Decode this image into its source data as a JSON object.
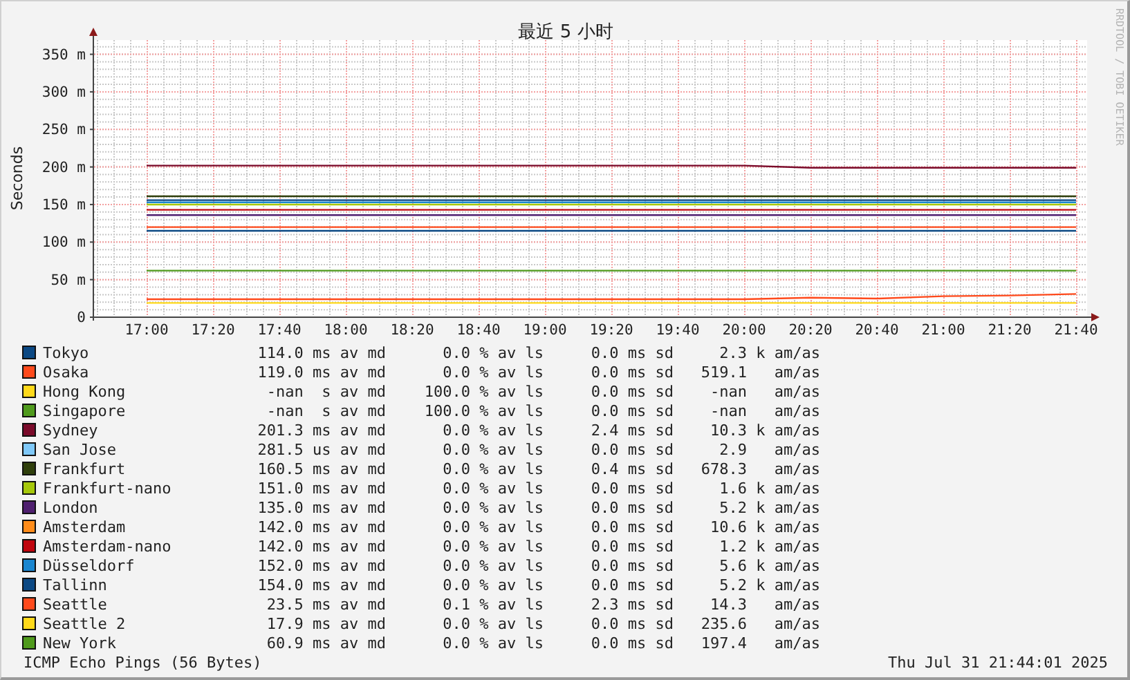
{
  "chart": {
    "credit": "RRDTOOL / TOBI OETIKER",
    "chart_data": {
      "type": "line",
      "title": "最近 5 小时",
      "ylabel": "Seconds",
      "grid": true,
      "categories": [
        "17:00",
        "17:20",
        "17:40",
        "18:00",
        "18:20",
        "18:40",
        "19:00",
        "19:20",
        "19:40",
        "20:00",
        "20:20",
        "20:40",
        "21:00",
        "21:20",
        "21:40"
      ],
      "ylim": [
        0,
        368
      ],
      "yticks": [
        {
          "value": 0,
          "label": "0"
        },
        {
          "value": 50,
          "label": "50 m"
        },
        {
          "value": 100,
          "label": "100 m"
        },
        {
          "value": 150,
          "label": "150 m"
        },
        {
          "value": 200,
          "label": "200 m"
        },
        {
          "value": 250,
          "label": "250 m"
        },
        {
          "value": 300,
          "label": "300 m"
        },
        {
          "value": 350,
          "label": "350 m"
        }
      ],
      "series": [
        {
          "name": "Tokyo",
          "color": "#0b4883",
          "values": [
            114,
            114,
            114,
            114,
            114,
            114,
            114,
            114,
            114,
            114,
            114,
            114,
            114,
            114,
            114
          ]
        },
        {
          "name": "Osaka",
          "color": "#ff4a1c",
          "values": [
            119,
            119,
            119,
            119,
            119,
            119,
            119,
            119,
            119,
            119,
            119,
            119,
            119,
            119,
            119
          ]
        },
        {
          "name": "Hong Kong",
          "color": "#ffd91a",
          "values": [
            null,
            null,
            null,
            null,
            null,
            null,
            null,
            null,
            null,
            null,
            null,
            null,
            null,
            null,
            null
          ]
        },
        {
          "name": "Singapore",
          "color": "#4f9a1c",
          "values": [
            null,
            null,
            null,
            null,
            null,
            null,
            null,
            null,
            null,
            null,
            null,
            null,
            null,
            null,
            null
          ]
        },
        {
          "name": "Sydney",
          "color": "#7a0a2a",
          "values": [
            201,
            201,
            201,
            201,
            201,
            201,
            201,
            201,
            201,
            201,
            198,
            198,
            198,
            198,
            198
          ]
        },
        {
          "name": "San Jose",
          "color": "#7fc8f8",
          "values": [
            null,
            null,
            null,
            null,
            null,
            null,
            null,
            null,
            null,
            null,
            null,
            null,
            null,
            null,
            null
          ]
        },
        {
          "name": "Frankfurt",
          "color": "#2f3f0b",
          "values": [
            160,
            160,
            160,
            160,
            160,
            160,
            160,
            160,
            160,
            160,
            160,
            160,
            160,
            160,
            160
          ]
        },
        {
          "name": "Frankfurt-nano",
          "color": "#a6c80a",
          "values": [
            149,
            149,
            149,
            149,
            149,
            149,
            149,
            149,
            149,
            149,
            149,
            149,
            149,
            149,
            149
          ]
        },
        {
          "name": "London",
          "color": "#4f1f6f",
          "values": [
            135,
            135,
            135,
            135,
            135,
            135,
            135,
            135,
            135,
            135,
            135,
            135,
            135,
            135,
            135
          ]
        },
        {
          "name": "Amsterdam",
          "color": "#ff8c1a",
          "values": [
            null,
            null,
            null,
            null,
            null,
            null,
            null,
            null,
            null,
            null,
            null,
            null,
            null,
            null,
            null
          ]
        },
        {
          "name": "Amsterdam-nano",
          "color": "#c0060e",
          "values": [
            142,
            142,
            142,
            142,
            142,
            142,
            142,
            142,
            142,
            142,
            142,
            142,
            142,
            142,
            142
          ]
        },
        {
          "name": "Düsseldorf",
          "color": "#1a86d0",
          "values": [
            152,
            152,
            152,
            152,
            152,
            152,
            152,
            152,
            152,
            152,
            152,
            152,
            152,
            152,
            152
          ]
        },
        {
          "name": "Tallinn",
          "color": "#0b4883",
          "values": [
            155,
            155,
            155,
            155,
            155,
            155,
            155,
            155,
            155,
            155,
            155,
            155,
            155,
            155,
            155
          ]
        },
        {
          "name": "Seattle",
          "color": "#ff4a1c",
          "values": [
            23,
            23,
            23,
            23,
            23,
            23,
            23,
            23,
            23,
            23,
            25,
            24,
            27,
            28,
            30
          ]
        },
        {
          "name": "Seattle 2",
          "color": "#ffd91a",
          "values": [
            18,
            18,
            18,
            18,
            18,
            18,
            18,
            18,
            18,
            18,
            18,
            18,
            18,
            18,
            18
          ]
        },
        {
          "name": "New York",
          "color": "#4f9a1c",
          "values": [
            61,
            61,
            61,
            61,
            61,
            61,
            61,
            61,
            61,
            61,
            61,
            61,
            61,
            61,
            61
          ]
        }
      ]
    }
  },
  "legend": [
    {
      "median": "114.0 ms av md",
      "loss": "0.0 % av ls",
      "stdev": "0.0 ms sd",
      "am_as": "2.3 k am/as"
    },
    {
      "median": "119.0 ms av md",
      "loss": "0.0 % av ls",
      "stdev": "0.0 ms sd",
      "am_as": "519.1   am/as"
    },
    {
      "median": "-nan  s av md",
      "loss": "100.0 % av ls",
      "stdev": "0.0 ms sd",
      "am_as": "-nan   am/as"
    },
    {
      "median": "-nan  s av md",
      "loss": "100.0 % av ls",
      "stdev": "0.0 ms sd",
      "am_as": "-nan   am/as"
    },
    {
      "median": "201.3 ms av md",
      "loss": "0.0 % av ls",
      "stdev": "2.4 ms sd",
      "am_as": "10.3 k am/as"
    },
    {
      "median": "281.5 us av md",
      "loss": "0.0 % av ls",
      "stdev": "0.0 ms sd",
      "am_as": "2.9   am/as"
    },
    {
      "median": "160.5 ms av md",
      "loss": "0.0 % av ls",
      "stdev": "0.4 ms sd",
      "am_as": "678.3   am/as"
    },
    {
      "median": "151.0 ms av md",
      "loss": "0.0 % av ls",
      "stdev": "0.0 ms sd",
      "am_as": "1.6 k am/as"
    },
    {
      "median": "135.0 ms av md",
      "loss": "0.0 % av ls",
      "stdev": "0.0 ms sd",
      "am_as": "5.2 k am/as"
    },
    {
      "median": "142.0 ms av md",
      "loss": "0.0 % av ls",
      "stdev": "0.0 ms sd",
      "am_as": "10.6 k am/as"
    },
    {
      "median": "142.0 ms av md",
      "loss": "0.0 % av ls",
      "stdev": "0.0 ms sd",
      "am_as": "1.2 k am/as"
    },
    {
      "median": "152.0 ms av md",
      "loss": "0.0 % av ls",
      "stdev": "0.0 ms sd",
      "am_as": "5.6 k am/as"
    },
    {
      "median": "154.0 ms av md",
      "loss": "0.0 % av ls",
      "stdev": "0.0 ms sd",
      "am_as": "5.2 k am/as"
    },
    {
      "median": "23.5 ms av md",
      "loss": "0.1 % av ls",
      "stdev": "2.3 ms sd",
      "am_as": "14.3   am/as"
    },
    {
      "median": "17.9 ms av md",
      "loss": "0.0 % av ls",
      "stdev": "0.0 ms sd",
      "am_as": "235.6   am/as"
    },
    {
      "median": "60.9 ms av md",
      "loss": "0.0 % av ls",
      "stdev": "0.0 ms sd",
      "am_as": "197.4   am/as"
    }
  ],
  "footer": {
    "description": "ICMP Echo Pings (56 Bytes)",
    "timestamp": "Thu Jul 31 21:44:01 2025"
  }
}
